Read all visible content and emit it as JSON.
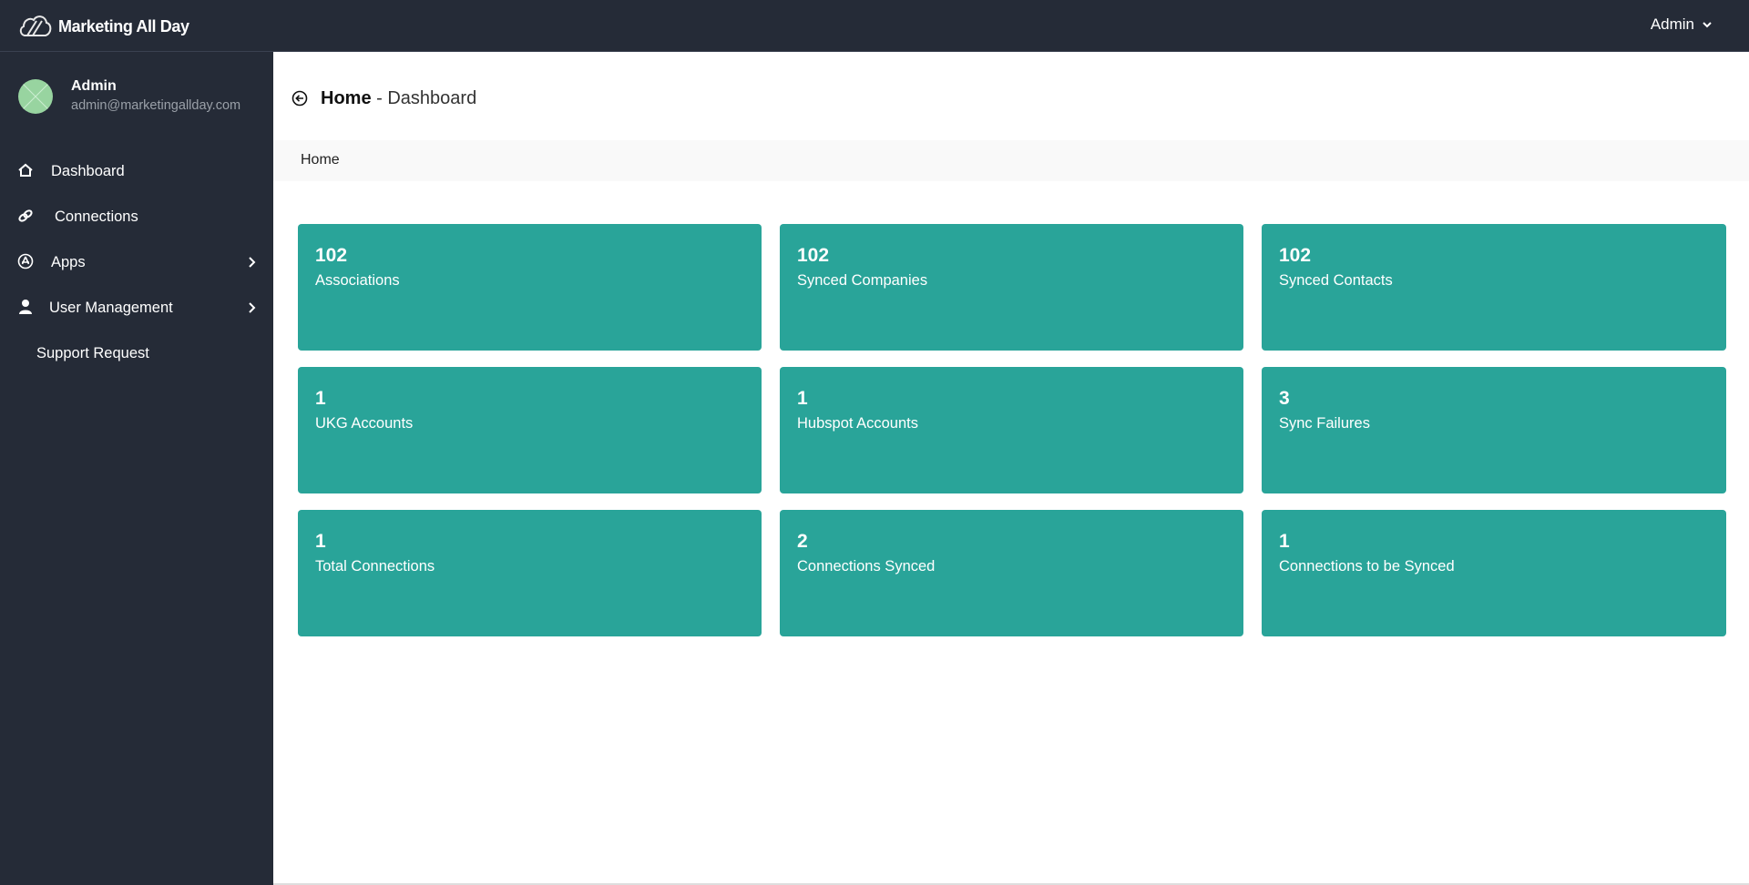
{
  "app": {
    "brand_name": "Marketing All Day",
    "user_menu_label": "Admin",
    "colors": {
      "chrome": "#252b37",
      "card": "#29a499",
      "avatar": "#98d4a0",
      "crumbbar": "#f9f9f9"
    }
  },
  "sidebar": {
    "profile": {
      "name": "Admin",
      "email": "admin@marketingallday.com"
    },
    "items": [
      {
        "label": "Dashboard",
        "icon": "home-icon",
        "has_children": false
      },
      {
        "label": "Connections",
        "icon": "link-icon",
        "has_children": false
      },
      {
        "label": "Apps",
        "icon": "apps-icon",
        "has_children": true
      },
      {
        "label": "User Management",
        "icon": "user-icon",
        "has_children": true
      },
      {
        "label": "Support Request",
        "icon": null,
        "has_children": false
      }
    ]
  },
  "page": {
    "title_strong": "Home",
    "title_rest": " - Dashboard",
    "breadcrumb": [
      "Home"
    ]
  },
  "cards": [
    {
      "value": "102",
      "label": "Associations"
    },
    {
      "value": "102",
      "label": "Synced Companies"
    },
    {
      "value": "102",
      "label": "Synced Contacts"
    },
    {
      "value": "1",
      "label": "UKG Accounts"
    },
    {
      "value": "1",
      "label": "Hubspot Accounts"
    },
    {
      "value": "3",
      "label": "Sync Failures"
    },
    {
      "value": "1",
      "label": "Total Connections"
    },
    {
      "value": "2",
      "label": "Connections Synced"
    },
    {
      "value": "1",
      "label": "Connections to be Synced"
    }
  ]
}
